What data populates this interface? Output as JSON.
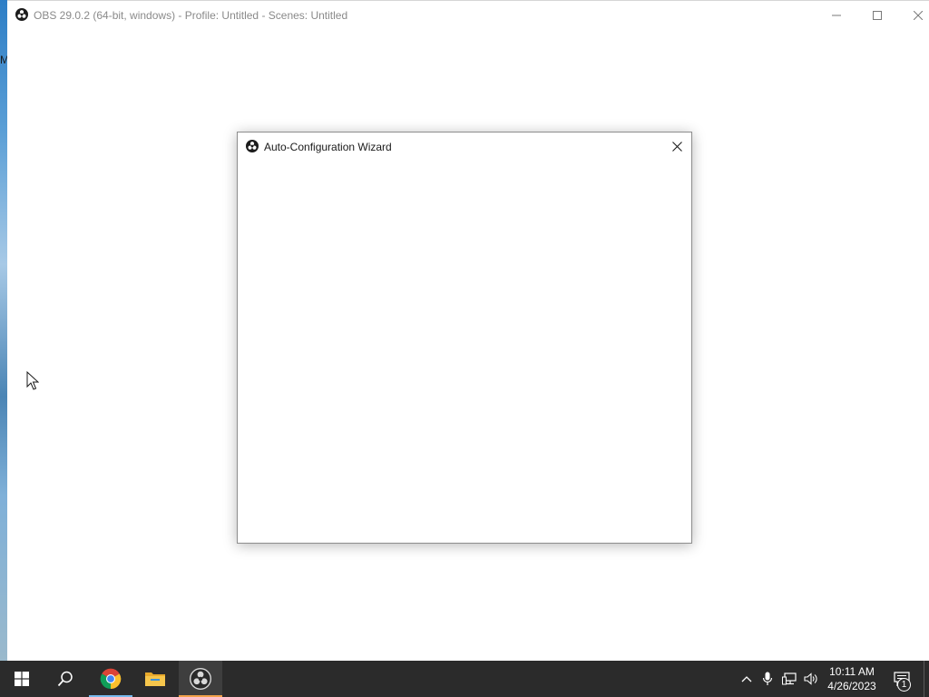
{
  "desktop": {
    "edge_text": "M"
  },
  "main_window": {
    "title": "OBS 29.0.2 (64-bit, windows) - Profile: Untitled - Scenes: Untitled",
    "icons": {
      "app": "obs-logo-icon",
      "minimize": "minimize-icon",
      "maximize": "maximize-icon",
      "close": "close-icon"
    }
  },
  "dialog": {
    "title": "Auto-Configuration Wizard",
    "icons": {
      "app": "obs-logo-icon",
      "close": "close-icon"
    }
  },
  "taskbar": {
    "pinned": [
      {
        "name": "start",
        "icon": "windows-start-icon"
      },
      {
        "name": "search",
        "icon": "search-icon"
      },
      {
        "name": "chrome",
        "icon": "chrome-icon"
      },
      {
        "name": "file-explorer",
        "icon": "folder-icon"
      },
      {
        "name": "obs-studio",
        "icon": "obs-logo-icon",
        "active": true
      }
    ],
    "tray": {
      "icons": [
        "chevron-up-icon",
        "microphone-icon",
        "network-icon",
        "volume-icon"
      ],
      "time": "10:11 AM",
      "date": "4/26/2023",
      "notification_count": "1"
    }
  },
  "colors": {
    "taskbar_bg": "#2b2b2b",
    "active_indicator": "#f2a14a",
    "window_bg": "#ffffff",
    "title_text": "#8a8a8a"
  }
}
